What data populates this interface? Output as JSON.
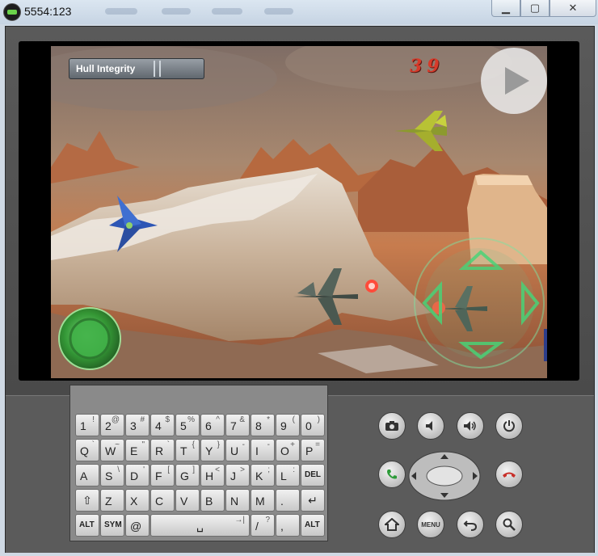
{
  "window": {
    "title": "5554:123",
    "minimize_icon": "minimize-icon",
    "maximize_icon": "maximize-icon",
    "close_icon": "close-icon"
  },
  "game": {
    "hud_label": "Hull Integrity",
    "hull_integrity_level": 0.35,
    "score": "39",
    "play_button_icon": "play-icon",
    "joystick_icon": "green-joystick",
    "dpad_icon": "green-arrow-dpad"
  },
  "keyboard": {
    "rows": [
      [
        {
          "main": "1",
          "sub": "!"
        },
        {
          "main": "2",
          "sub": "@"
        },
        {
          "main": "3",
          "sub": "#"
        },
        {
          "main": "4",
          "sub": "$"
        },
        {
          "main": "5",
          "sub": "%"
        },
        {
          "main": "6",
          "sub": "^"
        },
        {
          "main": "7",
          "sub": "&"
        },
        {
          "main": "8",
          "sub": "*"
        },
        {
          "main": "9",
          "sub": "("
        },
        {
          "main": "0",
          "sub": ")"
        }
      ],
      [
        {
          "main": "Q",
          "sub": "`"
        },
        {
          "main": "W",
          "sub": "~"
        },
        {
          "main": "E",
          "sub": "\""
        },
        {
          "main": "R",
          "sub": "`"
        },
        {
          "main": "T",
          "sub": "{"
        },
        {
          "main": "Y",
          "sub": "}"
        },
        {
          "main": "U",
          "sub": "-"
        },
        {
          "main": "I",
          "sub": "-"
        },
        {
          "main": "O",
          "sub": "+"
        },
        {
          "main": "P",
          "sub": "="
        }
      ],
      [
        {
          "main": "A",
          "sub": ""
        },
        {
          "main": "S",
          "sub": "\\"
        },
        {
          "main": "D",
          "sub": "'"
        },
        {
          "main": "F",
          "sub": "["
        },
        {
          "main": "G",
          "sub": "]"
        },
        {
          "main": "H",
          "sub": "<"
        },
        {
          "main": "J",
          "sub": ">"
        },
        {
          "main": "K",
          "sub": ";"
        },
        {
          "main": "L",
          "sub": ":"
        },
        {
          "main": "DEL",
          "sub": ""
        }
      ],
      [
        {
          "main": "⇧",
          "sub": ""
        },
        {
          "main": "Z",
          "sub": ""
        },
        {
          "main": "X",
          "sub": ""
        },
        {
          "main": "C",
          "sub": ""
        },
        {
          "main": "V",
          "sub": ""
        },
        {
          "main": "B",
          "sub": ""
        },
        {
          "main": "N",
          "sub": ""
        },
        {
          "main": "M",
          "sub": ""
        },
        {
          "main": ".",
          "sub": ""
        },
        {
          "main": "↵",
          "sub": ""
        }
      ],
      [
        {
          "main": "ALT",
          "sub": ""
        },
        {
          "main": "SYM",
          "sub": ""
        },
        {
          "main": "@",
          "sub": ""
        },
        {
          "main": "␣",
          "sub": "→|"
        },
        {
          "main": "/",
          "sub": "?"
        },
        {
          "main": ",",
          "sub": ""
        },
        {
          "main": "ALT",
          "sub": ""
        }
      ]
    ]
  },
  "controls": {
    "top": [
      "camera-icon",
      "volume-down-icon",
      "volume-up-icon",
      "power-icon"
    ],
    "call": "call-icon",
    "end_call": "end-call-icon",
    "bottom": [
      "home-icon",
      "menu-button",
      "back-icon",
      "search-icon"
    ],
    "menu_label": "MENU"
  }
}
